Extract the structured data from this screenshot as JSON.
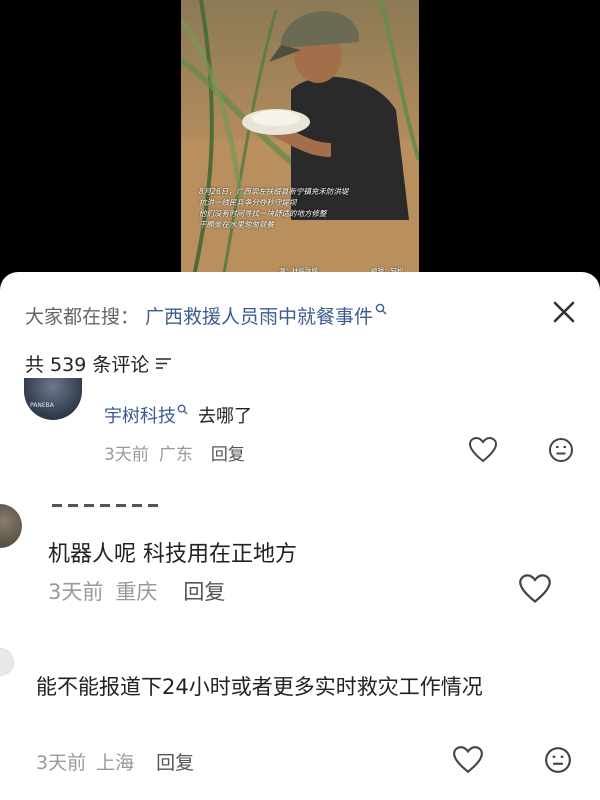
{
  "video": {
    "caption_lines": [
      "8月26日，广西崇左扶绥县新宁镇充禾防洪堤",
      "抗洪一线民兵争分夺秒守堤坝",
      "他们没有时间寻找一块舒适的地方修整",
      "干脆坐在水里匆匆就餐"
    ],
    "credit_left": "源：扶绥融媒",
    "credit_right": "编辑：轻松"
  },
  "search": {
    "prefix": "大家都在搜：",
    "term": "广西救援人员雨中就餐事件",
    "term_icon": "search-icon"
  },
  "header": {
    "comment_count": "共 539 条评论",
    "sort_icon": "sort-icon",
    "close_icon": "close-icon"
  },
  "comments": [
    {
      "avatar_text": "PANEBA",
      "username": "宇树科技",
      "user_icon": "search-icon",
      "text": "去哪了",
      "time": "3天前",
      "location": "广东",
      "reply_label": "回复",
      "icons": [
        "heart-icon",
        "emoji-icon"
      ]
    },
    {
      "text": "机器人呢 科技用在正地方",
      "time": "3天前",
      "location": "重庆",
      "reply_label": "回复",
      "icons": [
        "heart-icon"
      ]
    },
    {
      "text": "能不能报道下24小时或者更多实时救灾工作情况",
      "time": "3天前",
      "location": "上海",
      "reply_label": "回复",
      "icons": [
        "heart-icon",
        "emoji-icon"
      ]
    }
  ]
}
